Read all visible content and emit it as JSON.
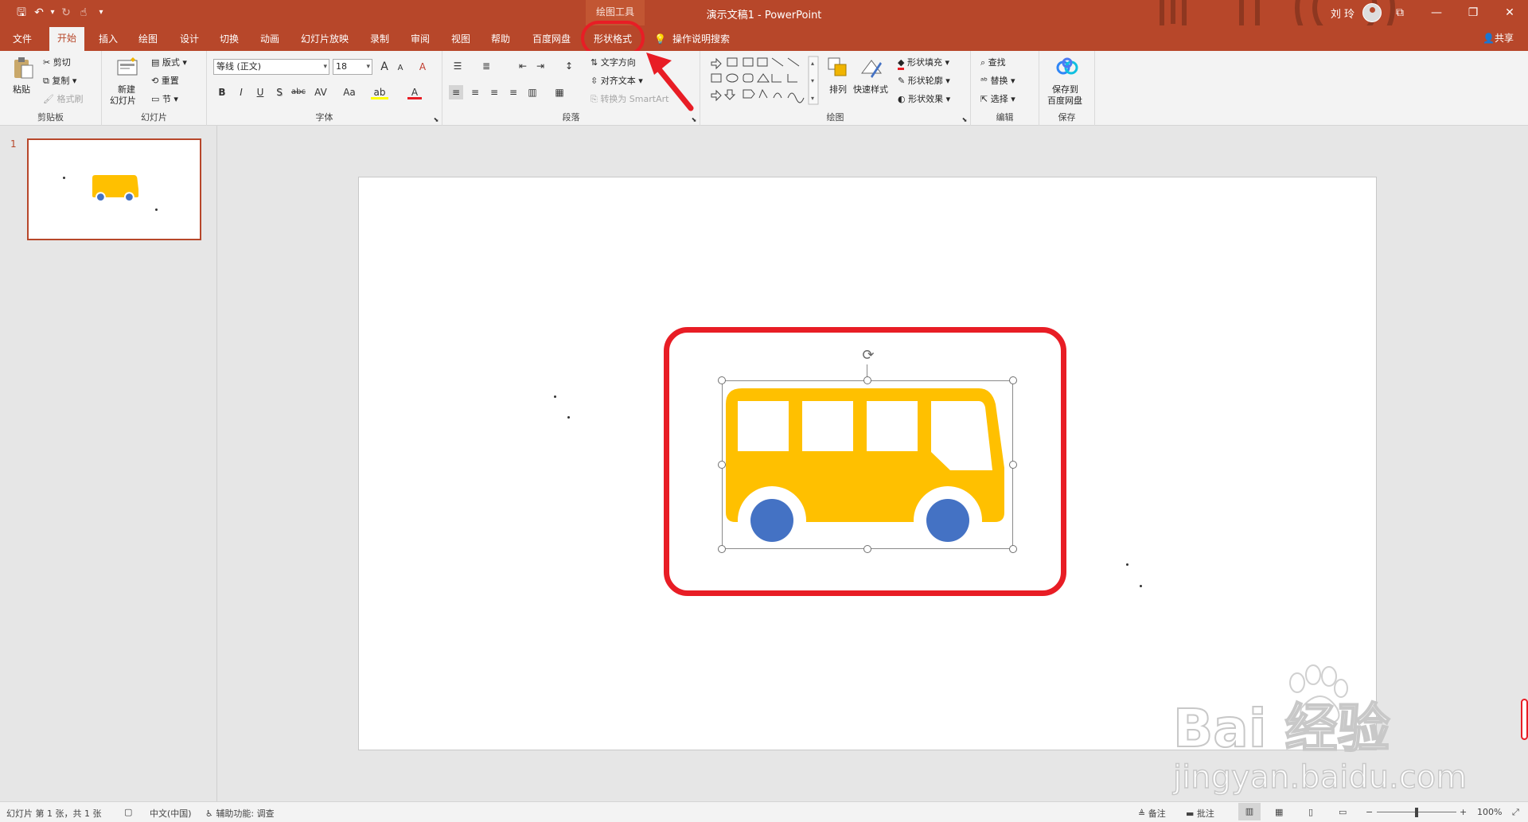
{
  "titlebar": {
    "qat_save": "🖫",
    "qat_undo": "↶",
    "qat_undo_drop": "▾",
    "qat_redo": "↻",
    "qat_touch": "☝",
    "qat_customize": "▾",
    "context_group": "绘图工具",
    "doc_title": "演示文稿1  -  PowerPoint",
    "user_name": "刘 玲",
    "ribbon_display": "⧉",
    "minimize": "—",
    "restore": "❐",
    "close": "✕"
  },
  "tabs": {
    "file": "文件",
    "home": "开始",
    "insert": "插入",
    "draw": "绘图",
    "design": "设计",
    "transitions": "切换",
    "animations": "动画",
    "slideshow": "幻灯片放映",
    "record": "录制",
    "review": "审阅",
    "view": "视图",
    "help": "帮助",
    "baidu": "百度网盘",
    "shape_format": "形状格式",
    "tell_me": "操作说明搜索",
    "share": "共享"
  },
  "ribbon": {
    "clipboard": {
      "paste": "粘贴",
      "cut": "剪切",
      "copy": "复制",
      "format_painter": "格式刷",
      "label": "剪贴板"
    },
    "slides": {
      "new_slide_line1": "新建",
      "new_slide_line2": "幻灯片",
      "layout": "版式",
      "reset": "重置",
      "section": "节",
      "label": "幻灯片"
    },
    "font": {
      "font_name": "等线 (正文)",
      "font_size": "18",
      "grow": "A",
      "shrink": "A",
      "clear": "A",
      "bold": "B",
      "italic": "I",
      "underline": "U",
      "shadow": "S",
      "strike": "abc",
      "spacing": "AV",
      "case": "Aa",
      "highlight": "ab",
      "color": "A",
      "label": "字体"
    },
    "paragraph": {
      "text_direction": "文字方向",
      "align_text": "对齐文本",
      "convert_smartart": "转换为 SmartArt",
      "label": "段落"
    },
    "drawing": {
      "arrange": "排列",
      "quick_styles": "快速样式",
      "shape_fill": "形状填充",
      "shape_outline": "形状轮廓",
      "shape_effects": "形状效果",
      "label": "绘图"
    },
    "editing": {
      "find": "查找",
      "replace": "替换",
      "select": "选择",
      "label": "编辑"
    },
    "save": {
      "save_line1": "保存到",
      "save_line2": "百度网盘",
      "label": "保存"
    }
  },
  "slide_panel": {
    "slide_number": "1"
  },
  "statusbar": {
    "slide_info": "幻灯片 第 1 张，共 1 张",
    "language": "中文(中国)",
    "accessibility": "辅助功能: 调查",
    "notes": "备注",
    "comments": "批注",
    "zoom_minus": "−",
    "zoom_plus": "+",
    "zoom": "100%"
  },
  "watermark": {
    "brand": "Bai 经验",
    "url": "jingyan.baidu.com"
  },
  "colors": {
    "accent": "#b7472a",
    "bus_body": "#ffc000",
    "bus_wheels": "#4472c4",
    "highlight": "#e81d25"
  }
}
